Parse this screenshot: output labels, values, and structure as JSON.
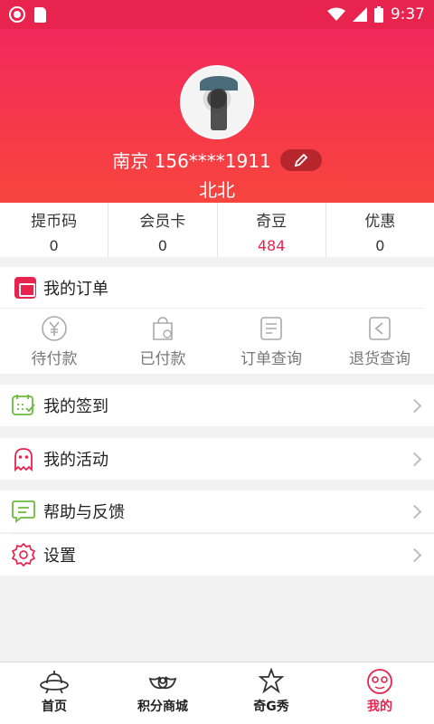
{
  "status_bar": {
    "time": "9:37"
  },
  "profile": {
    "phone_label": "南京 156****1911",
    "nickname": "北北"
  },
  "stats": [
    {
      "label": "提币码",
      "value": "0"
    },
    {
      "label": "会员卡",
      "value": "0"
    },
    {
      "label": "奇豆",
      "value": "484"
    },
    {
      "label": "优惠",
      "value": "0"
    }
  ],
  "orders": {
    "title": "我的订单",
    "items": [
      {
        "label": "待付款",
        "icon": "yen-icon"
      },
      {
        "label": "已付款",
        "icon": "paid-bag-icon"
      },
      {
        "label": "订单查询",
        "icon": "order-list-icon"
      },
      {
        "label": "退货查询",
        "icon": "return-icon"
      }
    ]
  },
  "menu": {
    "checkin": "我的签到",
    "activity": "我的活动",
    "feedback": "帮助与反馈",
    "settings": "设置"
  },
  "tabs": [
    {
      "label": "首页",
      "icon": "ufo-icon"
    },
    {
      "label": "积分商城",
      "icon": "wings-icon"
    },
    {
      "label": "奇G秀",
      "icon": "star-figure-icon"
    },
    {
      "label": "我的",
      "icon": "face-icon"
    }
  ],
  "colors": {
    "accent": "#e8234e",
    "header_top": "#f2285e",
    "header_bottom": "#f7453e",
    "checkin_green": "#6dbb3c"
  }
}
